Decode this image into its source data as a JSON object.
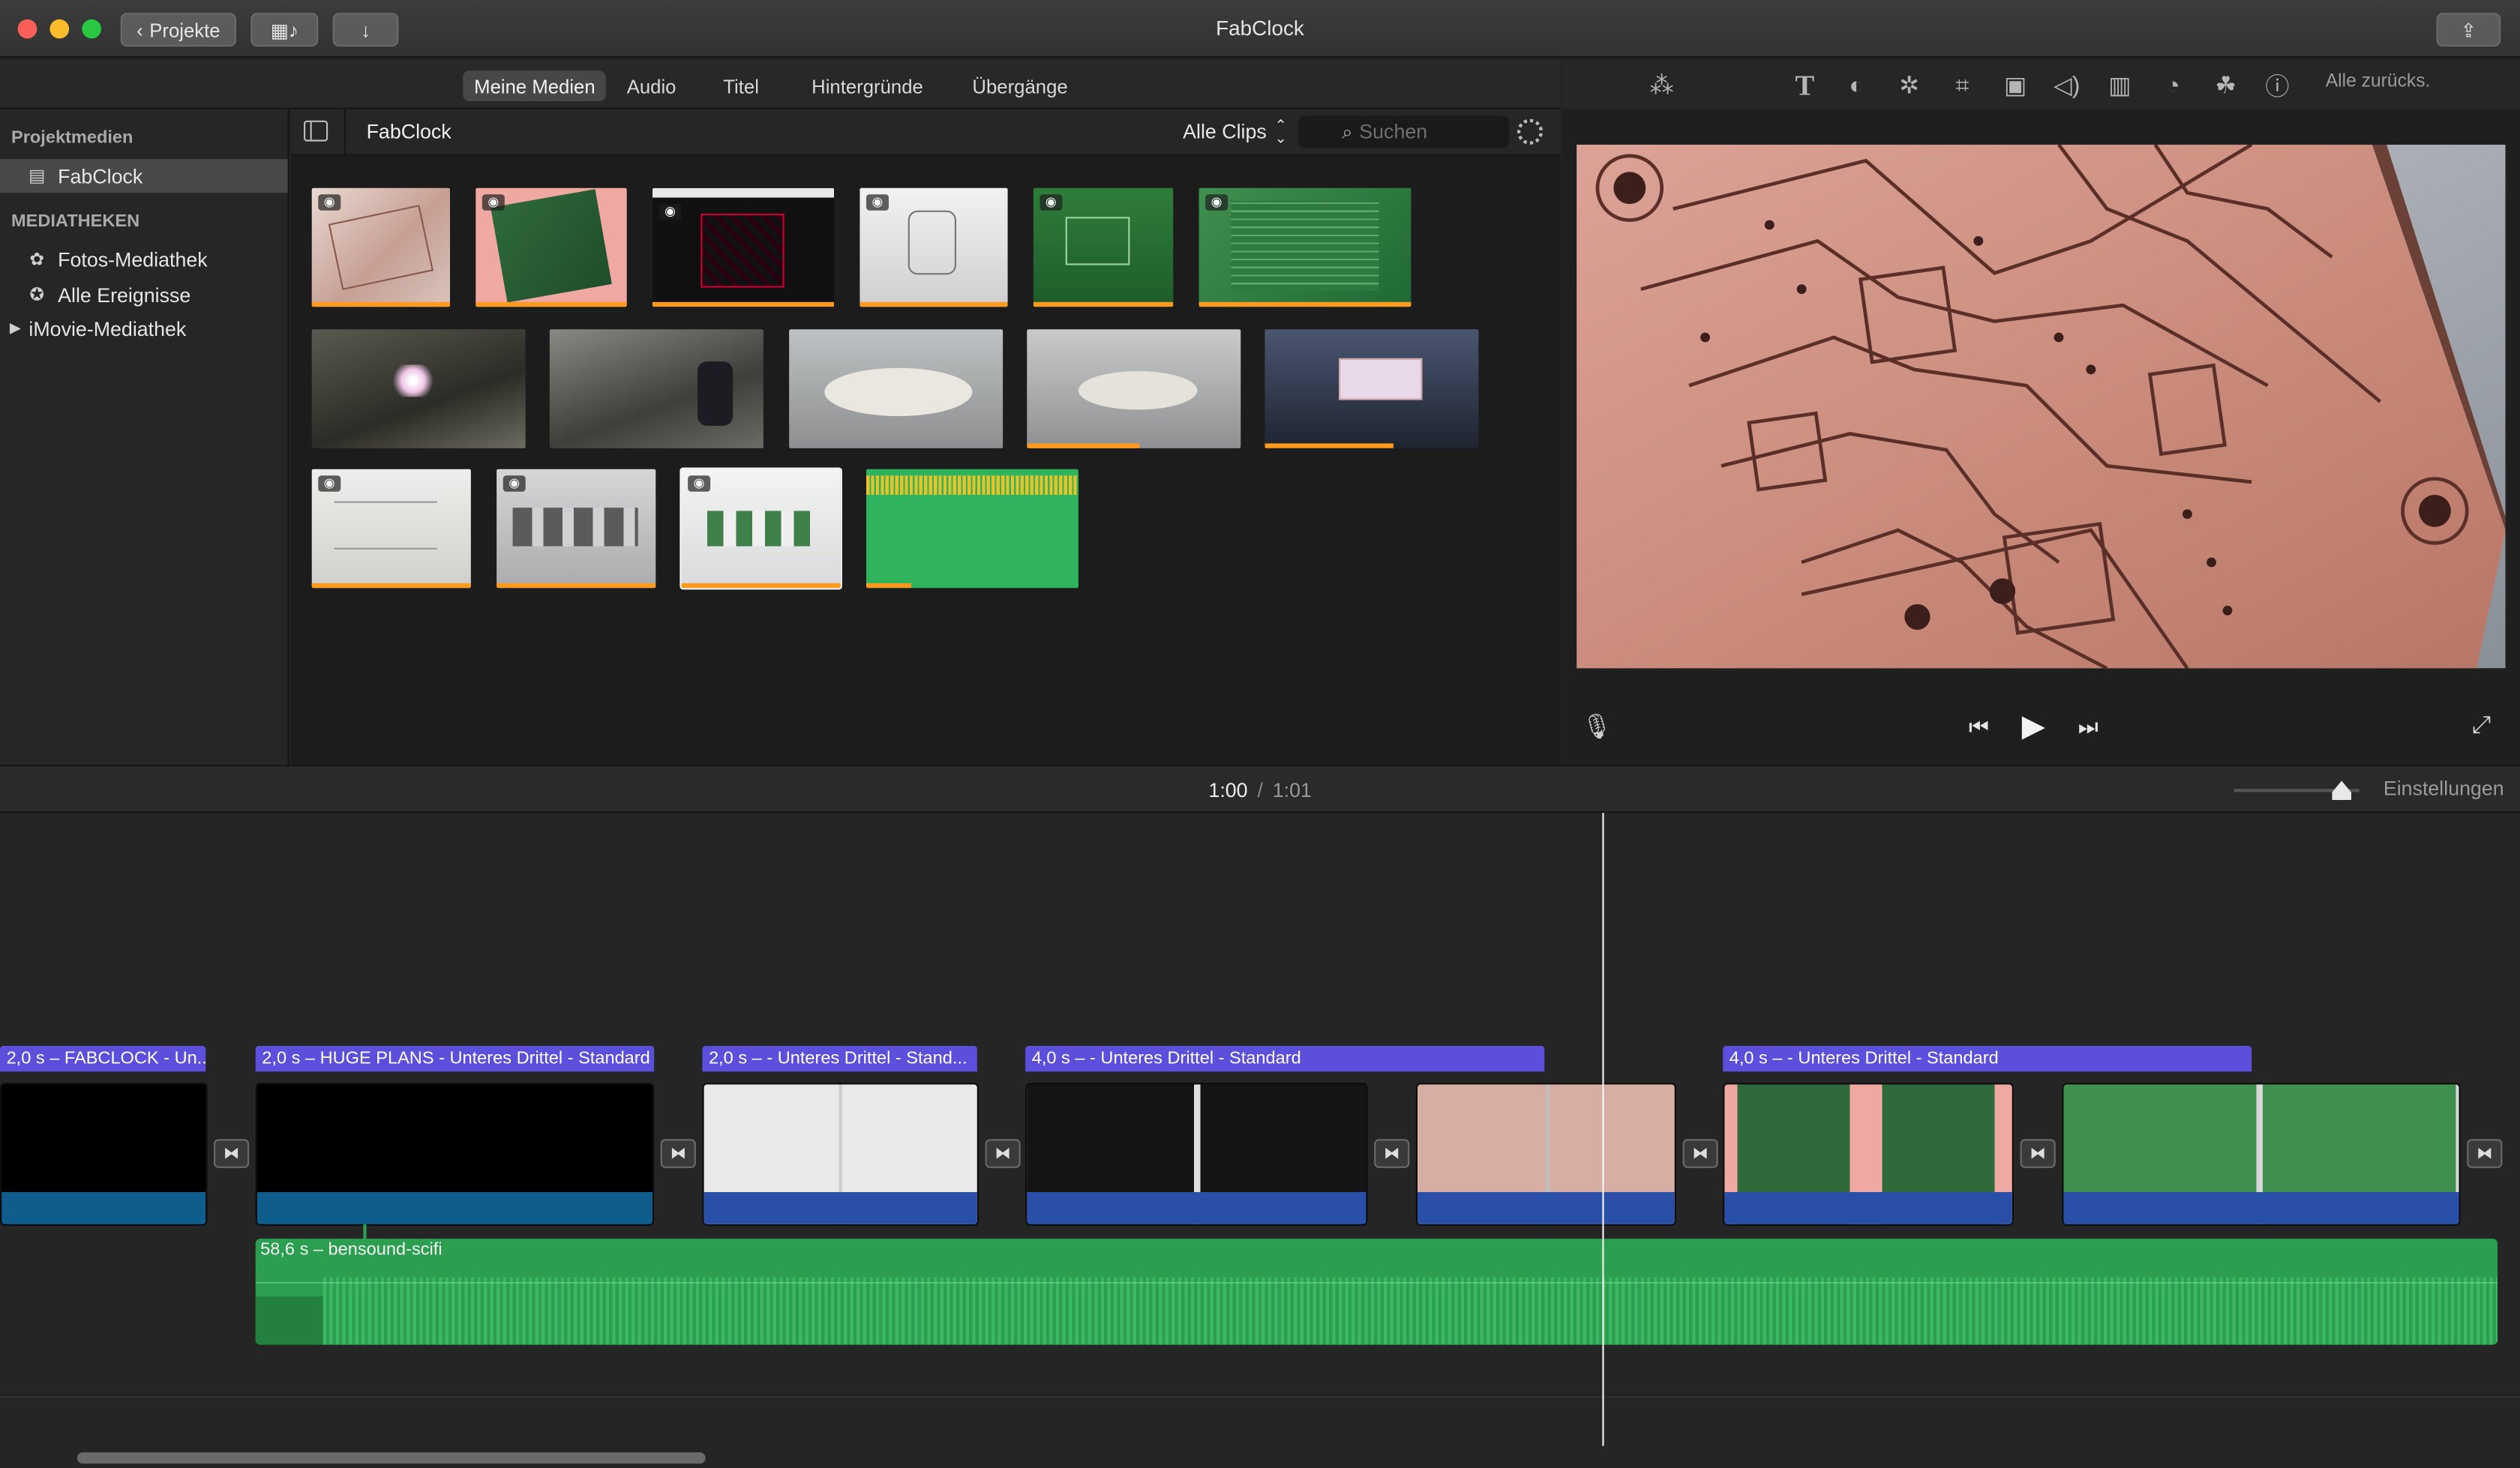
{
  "window": {
    "title": "FabClock",
    "back_button": "Projekte"
  },
  "tabs": [
    {
      "label": "Meine Medien"
    },
    {
      "label": "Audio"
    },
    {
      "label": "Titel"
    },
    {
      "label": "Hintergründe"
    },
    {
      "label": "Übergänge"
    }
  ],
  "sidebar": {
    "project_header": "Projektmedien",
    "project_item": "FabClock",
    "libraries_header": "MEDIATHEKEN",
    "items": [
      {
        "label": "Fotos-Mediathek"
      },
      {
        "label": "Alle Ereignisse"
      },
      {
        "label": "iMovie-Mediathek"
      }
    ]
  },
  "browser": {
    "title": "FabClock",
    "filter": "Alle Clips",
    "search_placeholder": "Suchen"
  },
  "viewer": {
    "reset_all": "Alle zurücks."
  },
  "timeline": {
    "current_time": "1:00",
    "separator": "/",
    "total_time": "1:01",
    "settings_label": "Einstellungen",
    "title_labels": [
      "2,0 s – FABCLOCK - Un...",
      "2,0 s – HUGE PLANS - Unteres Drittel - Standard",
      "2,0 s –   - Unteres Drittel - Stand...",
      "4,0 s –   - Unteres Drittel - Standard",
      "4,0 s –   - Unteres Drittel - Standard"
    ],
    "audio_label": "58,6 s – bensound-scifi"
  },
  "colors": {
    "title_clip": "#5b4fdc",
    "audio_clip": "#2b9e50",
    "video_bar": "#2a4fa8",
    "usage_bar": "#ff9a1f"
  }
}
